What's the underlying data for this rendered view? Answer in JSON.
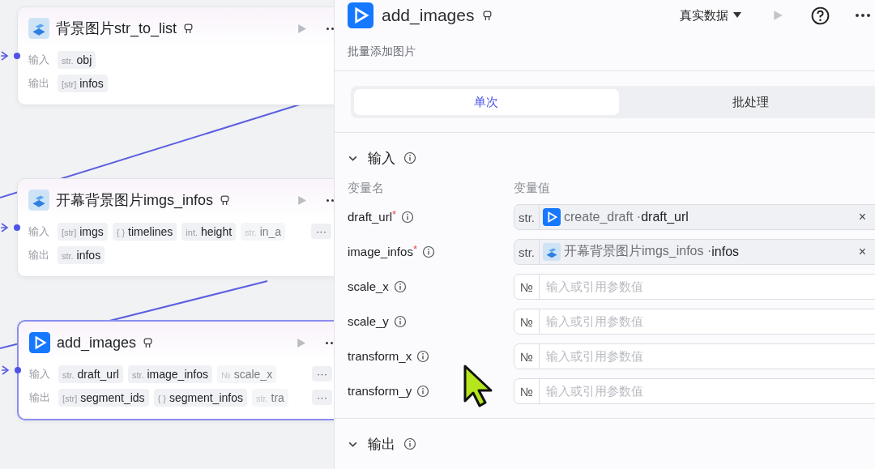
{
  "canvas": {
    "nodes": [
      {
        "title": "背景图片str_to_list",
        "kind": "cube",
        "selected": false,
        "rows": [
          {
            "label": "输入",
            "tags": [
              {
                "type": "str.",
                "name": "obj",
                "faded": false
              }
            ]
          },
          {
            "label": "输出",
            "tags": [
              {
                "type": "[str]",
                "name": "infos",
                "faded": false
              }
            ]
          }
        ]
      },
      {
        "title": "开幕背景图片imgs_infos",
        "kind": "cube",
        "selected": false,
        "rows": [
          {
            "label": "输入",
            "tags": [
              {
                "type": "[str]",
                "name": "imgs",
                "faded": false
              },
              {
                "type": "{ }",
                "name": "timelines",
                "faded": false
              },
              {
                "type": "int.",
                "name": "height",
                "faded": false
              },
              {
                "type": "str.",
                "name": "in_a",
                "faded": true
              }
            ],
            "overflow": "···"
          },
          {
            "label": "输出",
            "tags": [
              {
                "type": "str.",
                "name": "infos",
                "faded": false
              }
            ]
          }
        ]
      },
      {
        "title": "add_images",
        "kind": "play",
        "selected": true,
        "rows": [
          {
            "label": "输入",
            "tags": [
              {
                "type": "str.",
                "name": "draft_url",
                "faded": false
              },
              {
                "type": "str.",
                "name": "image_infos",
                "faded": false
              },
              {
                "type": "№",
                "name": "scale_x",
                "faded": true
              }
            ],
            "overflow": "···"
          },
          {
            "label": "输出",
            "tags": [
              {
                "type": "[str]",
                "name": "segment_ids",
                "faded": false
              },
              {
                "type": "{ }",
                "name": "segment_infos",
                "faded": false
              },
              {
                "type": "str.",
                "name": "tra",
                "faded": true
              }
            ],
            "overflow": "···"
          }
        ]
      }
    ]
  },
  "panel": {
    "title": "add_images",
    "kind": "play",
    "description": "批量添加图片",
    "data_mode": "真实数据",
    "tabs": [
      {
        "label": "单次",
        "selected": true
      },
      {
        "label": "批处理",
        "selected": false
      }
    ],
    "input": {
      "title": "输入",
      "expanded": true,
      "columns": [
        "变量名",
        "变量值"
      ],
      "params": [
        {
          "name": "draft_url",
          "required_mark": "*",
          "type": "str.",
          "ref": {
            "kind": "play",
            "node": "create_draft",
            "separator": "·",
            "field": "draft_url",
            "clear": "×"
          }
        },
        {
          "name": "image_infos",
          "required_mark": "*",
          "type": "str.",
          "ref": {
            "kind": "cube",
            "node": "开幕背景图片imgs_infos",
            "separator": "·",
            "field": "infos",
            "clear": "×"
          }
        },
        {
          "name": "scale_x",
          "type": "№",
          "placeholder": "输入或引用参数值"
        },
        {
          "name": "scale_y",
          "type": "№",
          "placeholder": "输入或引用参数值"
        },
        {
          "name": "transform_x",
          "type": "№",
          "placeholder": "输入或引用参数值"
        },
        {
          "name": "transform_y",
          "type": "№",
          "placeholder": "输入或引用参数值"
        }
      ]
    },
    "output": {
      "title": "输出",
      "expanded": true
    }
  }
}
